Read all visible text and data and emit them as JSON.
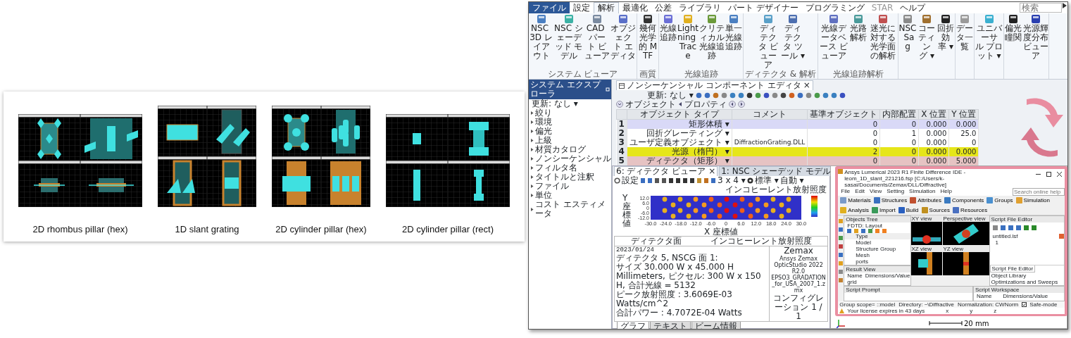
{
  "figure": {
    "items": [
      {
        "kind": "rhombus-hex",
        "caption": "2D rhombus pillar (hex)"
      },
      {
        "kind": "slant-grating",
        "caption": "1D slant grating"
      },
      {
        "kind": "cylinder-hex",
        "caption": "2D cylinder pillar (hex)"
      },
      {
        "kind": "cylinder-rect",
        "caption": "2D cylinder pillar (rect)"
      }
    ]
  },
  "zemax": {
    "menu_tabs": [
      {
        "label": "ファイル",
        "kind": "app",
        "selected": false,
        "disabled": false
      },
      {
        "label": "設定",
        "kind": "tab",
        "selected": false,
        "disabled": false
      },
      {
        "label": "解析",
        "kind": "tab",
        "selected": true,
        "disabled": false
      },
      {
        "label": "最適化",
        "kind": "tab",
        "selected": false,
        "disabled": false
      },
      {
        "label": "公差",
        "kind": "tab",
        "selected": false,
        "disabled": false
      },
      {
        "label": "ライブラリ",
        "kind": "tab",
        "selected": false,
        "disabled": false
      },
      {
        "label": "パート デザイナー",
        "kind": "tab",
        "selected": false,
        "disabled": false
      },
      {
        "label": "プログラミング",
        "kind": "tab",
        "selected": false,
        "disabled": false
      },
      {
        "label": "STAR",
        "kind": "tab",
        "selected": false,
        "disabled": true
      },
      {
        "label": "ヘルプ",
        "kind": "tab",
        "selected": false,
        "disabled": false
      }
    ],
    "search": {
      "placeholder": "検索"
    },
    "ribbon_groups": [
      {
        "label": "システム ビューア",
        "buttons": [
          "NSC 3D レイアウト",
          "NSC シェーデッド モデル",
          "CAD パート ビューア",
          "オブジェクト エディタ"
        ]
      },
      {
        "label": "画質",
        "buttons": [
          "幾何光学的 MTF"
        ]
      },
      {
        "label": "光線追跡",
        "buttons": [
          "光線追跡",
          "Lightning Trace",
          "クリティカル光線追跡",
          "単一光線追跡"
        ]
      },
      {
        "label": "ディテクタ & 解析",
        "buttons": [
          "ディテクタ ビューア",
          "ディテクタ ツール ▾"
        ]
      },
      {
        "label": "光線追跡解析",
        "buttons": [
          "光線データベース ビューア",
          "光路解析",
          "迷光に対する光学面の解析"
        ]
      },
      {
        "buttons": [
          "NSC Sag",
          "コーティング ▾",
          "回折効率 ▾"
        ]
      },
      {
        "buttons": [
          "データ一覧"
        ]
      },
      {
        "buttons": [
          "ユニバーサル プロット ▾"
        ]
      },
      {
        "buttons": [
          "偏光瞳関",
          "光源輝度分布ビューア"
        ]
      }
    ],
    "explorer": {
      "title": "システム エクスプローラ",
      "update": "更新: なし ▾",
      "items": [
        {
          "label": "絞り",
          "expanded": false
        },
        {
          "label": "環境",
          "expanded": false
        },
        {
          "label": "偏光",
          "expanded": false
        },
        {
          "label": "上級",
          "expanded": false
        },
        {
          "label": "材質カタログ",
          "expanded": false
        },
        {
          "label": "ノンシーケンシャル",
          "expanded": false
        },
        {
          "label": "フィルタ名",
          "expanded": false
        },
        {
          "label": "タイトルと注釈",
          "expanded": false
        },
        {
          "label": "ファイル",
          "expanded": false
        },
        {
          "label": "単位",
          "expanded": false
        },
        {
          "label": "コスト エスティメータ",
          "expanded": false
        }
      ]
    },
    "editor": {
      "tab": "ノンシーケンシャル コンポーネント エディタ",
      "close": "×",
      "update": "更新: なし ▾",
      "object_button": "オブジェクト",
      "property_button": "プロパティ",
      "columns": [
        "オブジェクト タイプ",
        "コメント",
        "基準オブジェクト",
        "内部配置",
        "X 位置",
        "Y 位置"
      ],
      "rows": [
        {
          "index": "1",
          "color": "#d9d9f7",
          "cells": [
            "矩形体積 ▾",
            "",
            "0",
            "0",
            "0.000",
            "0.000"
          ]
        },
        {
          "index": "2",
          "color": "#ffffff",
          "cells": [
            "回折グレーティング ▾",
            "",
            "0",
            "1",
            "0.000",
            "25.0"
          ]
        },
        {
          "index": "3",
          "color": "#ffffff",
          "cells": [
            "ユーザ定義オブジェクト ▾",
            "DiffractionGrating.DLL",
            "0",
            "0",
            "0.000",
            "0"
          ]
        },
        {
          "index": "4",
          "color": "#e6e619",
          "cells": [
            "光源（楕円） ▾",
            "",
            "2",
            "0",
            "0.000",
            "0.000"
          ]
        },
        {
          "index": "5",
          "color": "#e6c3c3",
          "cells": [
            "ディテクタ（矩形） ▾",
            "",
            "0",
            "0",
            "0.000",
            "5.000"
          ]
        }
      ]
    },
    "viewer": {
      "tabs": [
        {
          "label": "6: ディテクタ ビューア",
          "close": "×",
          "selected": true
        },
        {
          "label": "1: NSC シェーデッド モデル",
          "selected": false
        }
      ],
      "settings": "設定",
      "grid_menu": "3 x 4 ▾",
      "standard_menu": "標準 ▾",
      "auto_menu": "自動 ▾",
      "plot": {
        "colorbar_title": "インコヒーレント放射照度",
        "xlabel": "X 座標値",
        "ylabel": "Y 座標値",
        "xticks": [
          "-30.0",
          "-24.0",
          "-18.0",
          "-12.0",
          "-6.0",
          "0",
          "6.0",
          "12.0",
          "18.0",
          "24.0",
          "30.0"
        ],
        "yticks": [
          "12.0",
          "6.0",
          "0",
          "-6.0",
          "-12.0"
        ]
      },
      "info": {
        "header_left": "ディテクタ面",
        "header_right": "インコヒーレント放射照度",
        "left_lines": [
          "2023/01/24",
          "ディテクタ 5, NSCG 面 1:",
          "サイズ 30.000 W x 45.000 H Millimeters, ピクセル: 300 W x 150 H, 合計光線 = 5132",
          "ピーク放射照度 : 3.6069E-03 Watts/cm^2",
          "合計パワー : 4.7072E-04 Watts"
        ],
        "right_lines": [
          "Zemax",
          "Ansys Zemax OpticStudio 2022 R2.0",
          "EPSO3_GRADATION_for_USA_2007_1.zmx",
          "コンフィグレーション 1 / 1"
        ]
      },
      "bottom_tabs": [
        {
          "label": "グラフ",
          "selected": true
        },
        {
          "label": "テキスト",
          "selected": false
        },
        {
          "label": "ビーム情報",
          "selected": false
        }
      ]
    },
    "layout3d": {
      "scale_label": "20 mm"
    }
  },
  "lumerical": {
    "title": "Ansys Lumerical 2023 R1 Finite Difference IDE - leom_1D_slant_221216.fsp [C:/Users/k-sasai/Documents/Zemax/DLL/Diffractive]",
    "menu": [
      "File",
      "Edit",
      "View",
      "Setting",
      "Simulation",
      "Help"
    ],
    "toolbar": [
      "Materials",
      "Structures",
      "Attributes",
      "Components",
      "Groups",
      "Simulation",
      "Analysis",
      "Import",
      "Build",
      "Sources",
      "Resources"
    ],
    "search": {
      "placeholder": "Search online help"
    },
    "objects_tree": {
      "title": "Objects Tree",
      "root": "FDTD: Layout",
      "column": "Type",
      "items": [
        "Model",
        "Structure Group",
        "Mesh",
        "ports"
      ]
    },
    "result_view": {
      "title": "Result View",
      "columns": [
        "Name",
        "Dimensions/Value"
      ],
      "items": [
        "grid"
      ]
    },
    "views": [
      "XY view",
      "Perspective view",
      "XZ view",
      "YZ view"
    ],
    "script_editor": {
      "title": "Script File Editor",
      "file": "untitled.lsf",
      "line": "1",
      "tabs": [
        {
          "label": "Script File Editor",
          "selected": true
        },
        {
          "label": "Object Library",
          "selected": false
        },
        {
          "label": "Optimizations and Sweeps",
          "selected": false
        }
      ]
    },
    "script_prompt": "Script Prompt",
    "workspace": {
      "title": "Script Workspace",
      "columns": [
        "Name",
        "Dimensions/Value"
      ]
    },
    "bottom_bar": [
      "Group scope= ::model",
      "Directory: ~\\Diffractive",
      "Normalization: CWNorm"
    ],
    "safe_mode": {
      "label": "Safe-mode",
      "checked": true
    },
    "status": "Your license expires in 43 days",
    "coords": [
      "x",
      "y",
      "z"
    ]
  }
}
